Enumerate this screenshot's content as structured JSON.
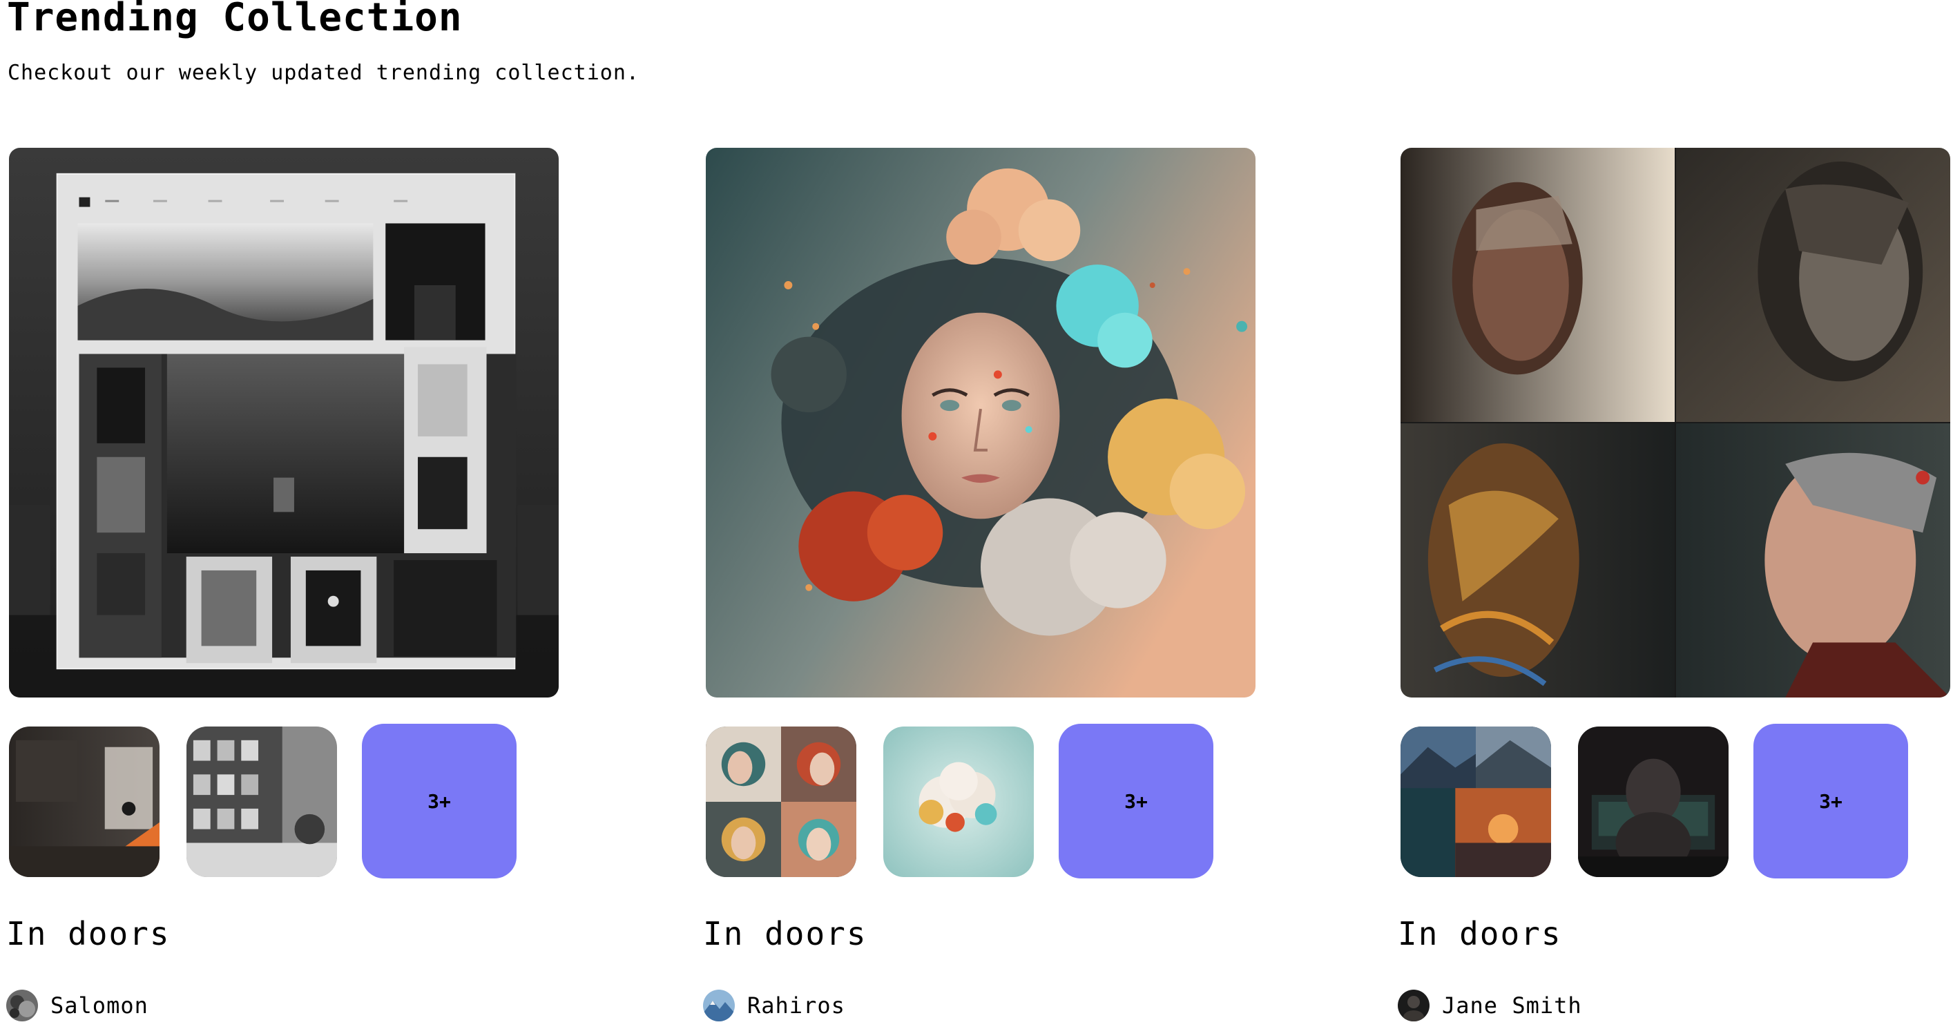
{
  "section": {
    "title": "Trending Collection",
    "subtitle": "Checkout our weekly updated trending collection."
  },
  "collections": [
    {
      "title": "In doors",
      "creator": "Salomon",
      "more_label": "3+",
      "hero_icon": "monochrome-gallery-website-mockup",
      "thumb_icons": [
        "dark-room-with-orange-light",
        "gray-room-with-framed-pictures"
      ],
      "avatar_icon": "gray-rock-avatar"
    },
    {
      "title": "In doors",
      "creator": "Rahiros",
      "more_label": "3+",
      "hero_icon": "woman-face-with-colorful-clouds",
      "thumb_icons": [
        "four-faces-with-colorful-clouds-grid",
        "colorful-cloud-on-teal"
      ],
      "avatar_icon": "blue-mountain-avatar"
    },
    {
      "title": "In doors",
      "creator": "Jane Smith",
      "more_label": "3+",
      "hero_icon": "four-cyborg-portraits-grid",
      "thumb_icons": [
        "landscape-sunset-collage",
        "hooded-figure-at-computer"
      ],
      "avatar_icon": "dark-portrait-avatar"
    }
  ],
  "colors": {
    "accent": "#7a78f6",
    "text": "#000000",
    "background": "#ffffff"
  }
}
